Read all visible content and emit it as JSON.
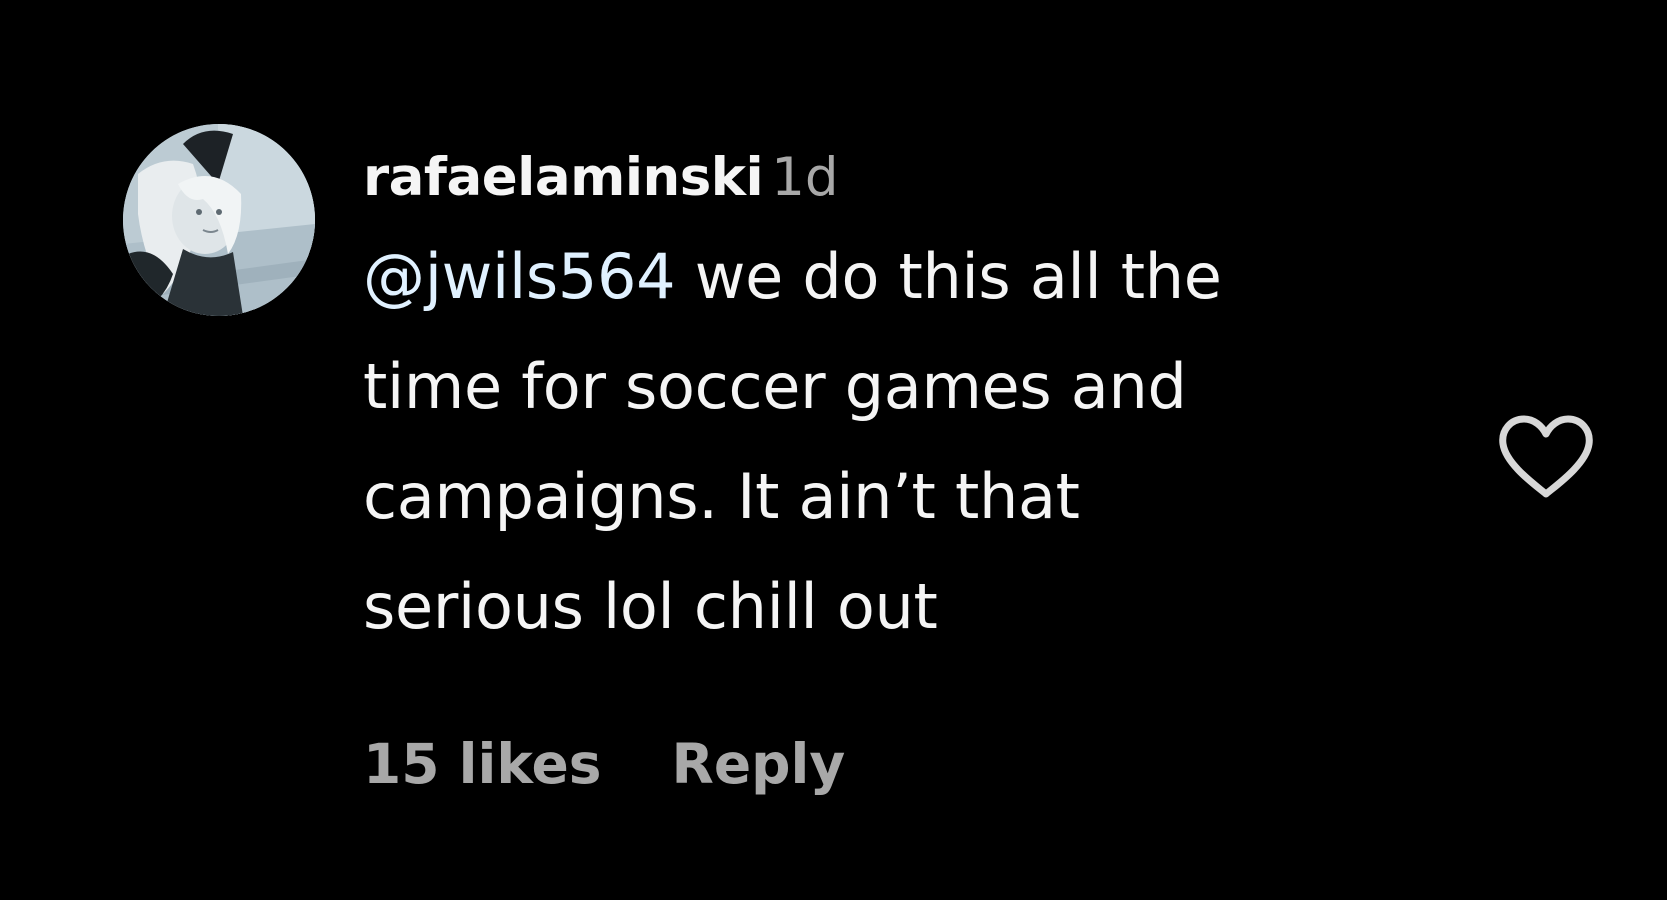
{
  "comment": {
    "username": "rafaelaminski",
    "timestamp": "1d",
    "mention": "@jwils564",
    "text_line_1": " we do this all the",
    "text_line_2": "time for soccer games and",
    "text_line_3": "campaigns. It ain’t that",
    "text_line_4": "serious lol chill out",
    "likes_label": "15 likes",
    "reply_label": "Reply"
  },
  "icons": {
    "like": "heart-outline-icon",
    "avatar": "profile-photo"
  },
  "colors": {
    "background": "#000000",
    "primary_text": "#f5f5f5",
    "secondary_text": "#a8a8a8",
    "mention": "#e0f1ff",
    "heart_stroke": "#d8d8d8"
  }
}
